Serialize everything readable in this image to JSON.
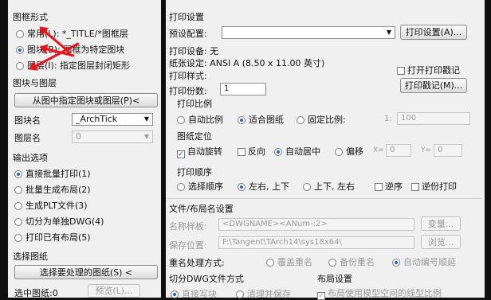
{
  "left": {
    "frame_style": {
      "title": "图框形式",
      "opt_common": "常用(L): *_TITLE/*图框层",
      "opt_block": "图块(B): 图框为特定图块",
      "opt_layer": "图层(I): 指定图层封闭矩形"
    },
    "block_layer": {
      "title": "图块与图层",
      "pick_btn": "从图中指定图块或图层(P)<",
      "block_label": "图块名",
      "block_value": "_ArchTick",
      "layer_label": "图层名",
      "layer_value": "0"
    },
    "output": {
      "title": "输出选项",
      "opt1": "直接批量打印(1)",
      "opt2": "批量生成布局(2)",
      "opt3": "生成PLT文件(3)",
      "opt4": "切分为单独DWG(4)",
      "opt5": "打印已有布局(5)"
    },
    "select": {
      "title": "选择图纸",
      "select_btn": "选择要处理的图纸(S) <",
      "selected_label": "选中图纸:0",
      "preview_btn": "预览(L)..."
    }
  },
  "right": {
    "print_settings": {
      "title": "打印设置",
      "preset_label": "预设配置:",
      "print_setup_btn": "打印设置(A)...",
      "device_label": "打印设备: 无",
      "paper_label": "纸张设定: ANSI A (8.50 x 11.00 英寸)",
      "style_label": "打印样式:",
      "open_log_label": "打开打印戳记",
      "copies_label": "打印份数:",
      "copies_value": "1",
      "stamp_btn": "打印戳记(M)..."
    },
    "scale": {
      "title": "打印比例",
      "opt_auto": "自动比例",
      "opt_fit": "适合图纸",
      "opt_fixed": "固定比例:",
      "ratio_prefix": "1:",
      "ratio_value": "100"
    },
    "position": {
      "title": "图纸定位",
      "auto_rotate": "自动旋转",
      "reverse": "反向",
      "auto_center": "自动居中",
      "offset": "偏移",
      "x_label": "X=",
      "x_value": "0",
      "y_label": "Y=",
      "y_value": "0"
    },
    "order": {
      "title": "打印顺序",
      "opt_select": "选择顺序",
      "opt_lr_tb": "左右, 上下",
      "opt_tb_lr": "上下, 左右",
      "reverse_order": "逆序",
      "reverse_print": "逆份打印"
    },
    "file_layout": {
      "title": "文件/布局名设置",
      "name_label": "名称样板:",
      "name_value": "<DWGNAME><ANum-:2>",
      "var_btn": "变量...",
      "save_label": "保存位置:",
      "save_value": "F:\\Tangent\\TArch14\\sys18x64\\",
      "browse_btn": "浏览...",
      "dup_label": "重名处理方式:",
      "dup_opt1": "覆盖重名",
      "dup_opt2": "备份重名",
      "dup_opt3": "自动编号顺延"
    },
    "split": {
      "title": "切分DWG文件方式",
      "opt1": "直接写块",
      "opt2": "清理并保存"
    },
    "layout": {
      "title": "布局设置",
      "use_model": "布局使用模型空间的线型比例"
    }
  }
}
